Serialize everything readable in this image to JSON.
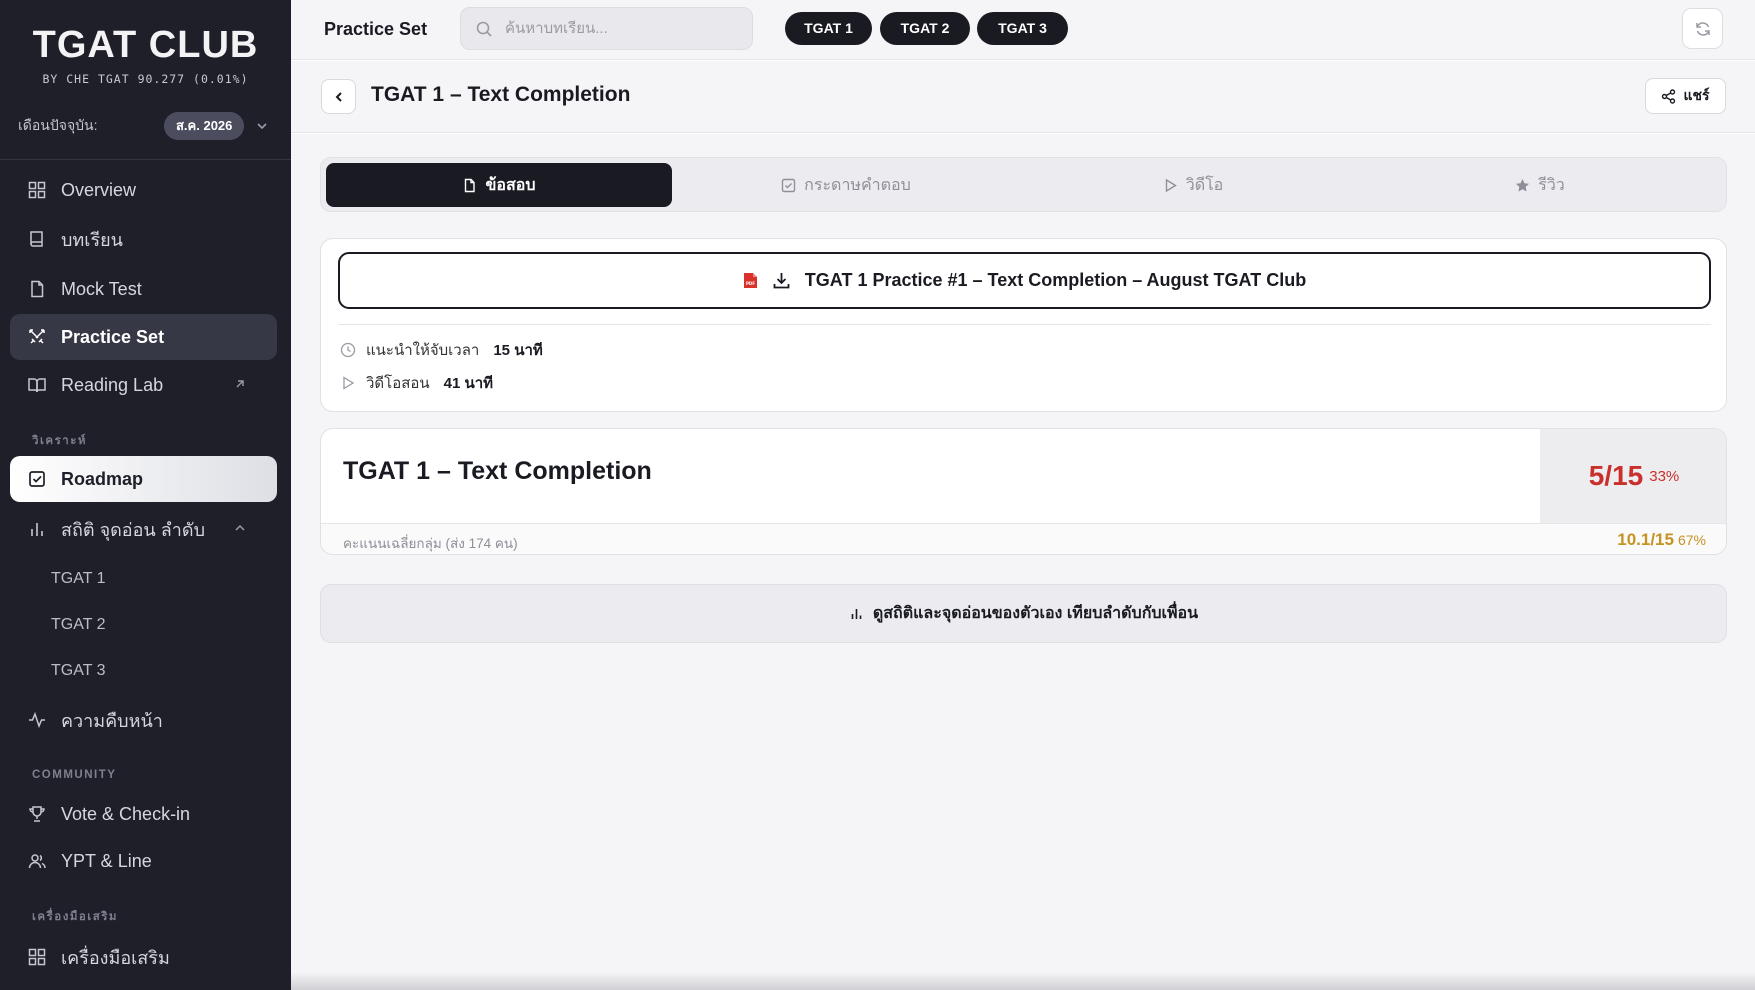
{
  "sidebar": {
    "brand_title": "TGAT CLUB",
    "brand_subtitle": "BY CHE TGAT 90.277 (0.01%)",
    "month_label": "เดือนปัจจุบัน:",
    "month_value": "ส.ค. 2026",
    "nav": [
      {
        "label": "Overview",
        "icon": "grid-icon"
      },
      {
        "label": "บทเรียน",
        "icon": "book-icon"
      },
      {
        "label": "Mock Test",
        "icon": "file-icon"
      },
      {
        "label": "Practice Set",
        "icon": "swords-icon"
      },
      {
        "label": "Reading Lab",
        "icon": "open-book-icon"
      }
    ],
    "section_analysis": "วิเคราะห์",
    "roadmap_label": "Roadmap",
    "stats_label": "สถิติ จุดอ่อน ลำดับ",
    "stats_sub": [
      "TGAT 1",
      "TGAT 2",
      "TGAT 3"
    ],
    "progress_label": "ความคืบหน้า",
    "section_community": "COMMUNITY",
    "vote_label": "Vote & Check-in",
    "ypt_label": "YPT & Line",
    "section_tools": "เครื่องมือเสริม",
    "tools_label": "เครื่องมือเสริม"
  },
  "topbar": {
    "title": "Practice Set",
    "search_placeholder": "ค้นหาบทเรียน...",
    "chips": [
      "TGAT 1",
      "TGAT 2",
      "TGAT 3"
    ]
  },
  "header": {
    "title": "TGAT 1 – Text Completion",
    "share_label": "แชร์"
  },
  "tabs": [
    {
      "label": "ข้อสอบ",
      "icon": "file-icon",
      "active": true
    },
    {
      "label": "กระดาษคำตอบ",
      "icon": "checkbox-icon",
      "active": false
    },
    {
      "label": "วิดีโอ",
      "icon": "play-icon",
      "active": false
    },
    {
      "label": "รีวิว",
      "icon": "star-icon",
      "active": false
    }
  ],
  "download": {
    "label": "TGAT 1 Practice #1 – Text Completion – August TGAT Club",
    "pdf_badge": "PDF"
  },
  "meta": {
    "time_label": "แนะนำให้จับเวลา",
    "time_value": "15 นาที",
    "video_label": "วิดีโอสอน",
    "video_value": "41 นาที"
  },
  "result": {
    "title": "TGAT 1 – Text Completion",
    "score": "5/15",
    "score_pct": "33%",
    "avg_label": "คะแนนเฉลี่ยกลุ่ม (ส่ง 174 คน)",
    "avg_value": "10.1/15",
    "avg_pct": "67%"
  },
  "stats_button": "ดูสถิติและจุดอ่อนของตัวเอง เทียบลำดับกับเพื่อน",
  "colors": {
    "sidebar_bg": "#1e1f28",
    "score_red": "#c9302c",
    "avg_gold": "#c79320",
    "dark": "#1a1b22"
  }
}
